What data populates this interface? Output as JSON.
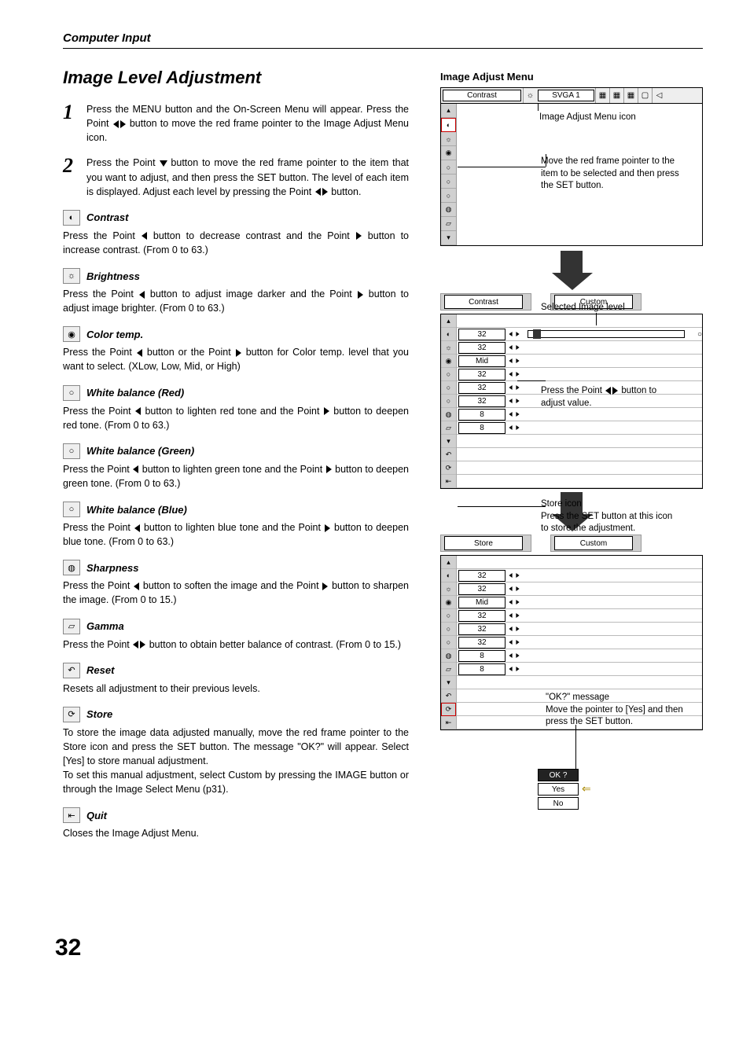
{
  "page": {
    "section": "Computer Input",
    "title": "Image Level Adjustment",
    "page_number": "32"
  },
  "steps": [
    {
      "num": "1",
      "text_a": "Press the MENU button and the On-Screen Menu will appear.  Press the Point ",
      "text_b": " button to move the red frame pointer to the Image Adjust Menu icon."
    },
    {
      "num": "2",
      "text_a": "Press the Point ",
      "text_b": " button to move the red frame pointer to the item that you want to adjust, and then press the SET button.  The level of each item is displayed.  Adjust each level by pressing the Point ",
      "text_c": " button."
    }
  ],
  "items": [
    {
      "title": "Contrast",
      "text_a": "Press the Point ",
      "text_b": " button to decrease contrast and the Point ",
      "text_c": " button to increase contrast.  (From 0 to 63.)",
      "icon": "contrast-icon",
      "glyph": "◐"
    },
    {
      "title": "Brightness",
      "text_a": "Press the Point ",
      "text_b": " button to adjust image darker and the Point ",
      "text_c": " button to adjust image brighter.  (From 0 to 63.)",
      "icon": "brightness-icon",
      "glyph": "☼"
    },
    {
      "title": "Color temp.",
      "text_a": "Press the Point ",
      "text_b": " button or the Point ",
      "text_c": "  button for Color temp. level that you want to select. (XLow, Low, Mid, or High)",
      "icon": "colortemp-icon",
      "glyph": "◉"
    },
    {
      "title": "White balance (Red)",
      "text_a": "Press the Point ",
      "text_b": " button to lighten red tone and the Point ",
      "text_c": " button to deepen red tone.  (From 0 to 63.)",
      "icon": "wb-red-icon",
      "glyph": "○"
    },
    {
      "title": "White balance (Green)",
      "text_a": "Press the Point ",
      "text_b": " button to lighten green tone and the Point ",
      "text_c": " button to deepen green tone.  (From 0 to 63.)",
      "icon": "wb-green-icon",
      "glyph": "○"
    },
    {
      "title": "White balance (Blue)",
      "text_a": "Press the Point ",
      "text_b": " button to lighten blue tone and the Point ",
      "text_c": " button to deepen blue tone.  (From 0 to 63.)",
      "icon": "wb-blue-icon",
      "glyph": "○"
    },
    {
      "title": "Sharpness",
      "text_a": "Press the Point ",
      "text_b": " button to soften the image and the Point ",
      "text_c": " button to sharpen the image.  (From 0 to 15.)",
      "icon": "sharpness-icon",
      "glyph": "◍"
    },
    {
      "title": "Gamma",
      "text_a": "Press the Point ",
      "text_b": "",
      "text_c": " button to obtain better balance of contrast.  (From 0 to 15.)",
      "icon": "gamma-icon",
      "glyph": "▱",
      "arrows": "lr"
    },
    {
      "title": "Reset",
      "text_plain": "Resets all adjustment to their previous levels.",
      "icon": "reset-icon",
      "glyph": "↶"
    },
    {
      "title": "Store",
      "text_plain": "To store the image data adjusted manually, move the red frame pointer to the Store icon and press the SET button. The message \"OK?\" will appear.  Select [Yes] to store manual adjustment.",
      "text_plain2": "To set this manual adjustment, select Custom by pressing the IMAGE button or through the Image Select Menu (p31).",
      "icon": "store-icon",
      "glyph": "⟳"
    },
    {
      "title": "Quit",
      "text_plain": "Closes the Image Adjust Menu.",
      "icon": "quit-icon",
      "glyph": "⇤"
    }
  ],
  "right": {
    "panel_title": "Image Adjust Menu",
    "top_bar": {
      "label": "Contrast",
      "source": "SVGA 1"
    },
    "anno": {
      "icon_label": "Image Adjust Menu icon",
      "move_frame": "Move the red frame pointer to the item to be selected and then press the SET button.",
      "selected_level": "Selected Image level",
      "press_point": "Press the Point ",
      "press_point_b": " button to adjust value.",
      "store_head": "Store icon",
      "store_text": "Press the SET button at this icon to store the adjustment.",
      "ok_head": "\"OK?\" message",
      "ok_text": "Move the pointer to [Yes] and then press the SET button."
    },
    "mid_row": {
      "left": "Contrast",
      "right": "Custom"
    },
    "values1": [
      "32",
      "32",
      "Mid",
      "32",
      "32",
      "32",
      "8",
      "8"
    ],
    "store_row": {
      "left": "Store",
      "right": "Custom"
    },
    "values2": [
      "32",
      "32",
      "Mid",
      "32",
      "32",
      "32",
      "8",
      "8"
    ],
    "dialog": {
      "ok": "OK ?",
      "yes": "Yes",
      "no": "No"
    }
  }
}
